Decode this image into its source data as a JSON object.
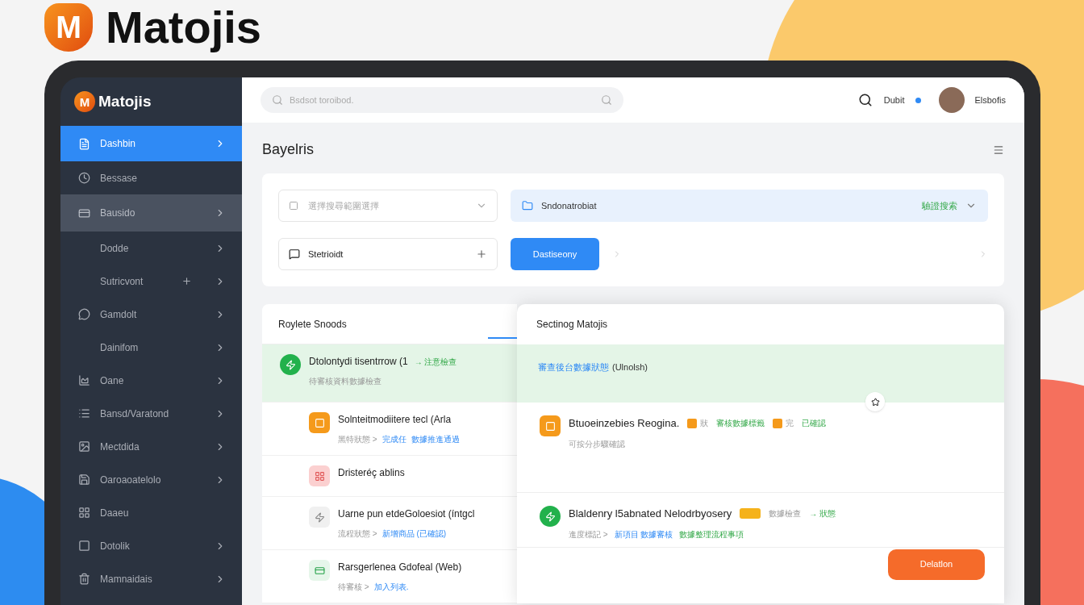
{
  "brand": {
    "mark": "M",
    "name": "Matojis"
  },
  "sidebar": {
    "brand": {
      "mark": "M",
      "name": "Matojis"
    },
    "items": [
      {
        "label": "Dashbin",
        "kind": "main",
        "selected": true,
        "highlighted": false,
        "plus": false,
        "chevron": true
      },
      {
        "label": "Bessase",
        "kind": "main",
        "selected": false,
        "highlighted": false,
        "plus": false,
        "chevron": false
      },
      {
        "label": "Bausido",
        "kind": "main",
        "selected": false,
        "highlighted": true,
        "plus": false,
        "chevron": true
      },
      {
        "label": "Dodde",
        "kind": "sub",
        "selected": false,
        "highlighted": false,
        "plus": false,
        "chevron": true
      },
      {
        "label": "Sutricvont",
        "kind": "sub",
        "selected": false,
        "highlighted": false,
        "plus": true,
        "chevron": true
      },
      {
        "label": "Gamdolt",
        "kind": "main",
        "selected": false,
        "highlighted": false,
        "plus": false,
        "chevron": true
      },
      {
        "label": "Dainifom",
        "kind": "sub",
        "selected": false,
        "highlighted": false,
        "plus": false,
        "chevron": true
      },
      {
        "label": "Oane",
        "kind": "main",
        "selected": false,
        "highlighted": false,
        "plus": false,
        "chevron": true
      },
      {
        "label": "Bansd/Varatond",
        "kind": "main",
        "selected": false,
        "highlighted": false,
        "plus": false,
        "chevron": true
      },
      {
        "label": "Mectdida",
        "kind": "main",
        "selected": false,
        "highlighted": false,
        "plus": false,
        "chevron": true
      },
      {
        "label": "Oaroaoatelolo",
        "kind": "main",
        "selected": false,
        "highlighted": false,
        "plus": false,
        "chevron": true
      },
      {
        "label": "Daaeu",
        "kind": "main",
        "selected": false,
        "highlighted": false,
        "plus": false,
        "chevron": false
      },
      {
        "label": "Dotolik",
        "kind": "main",
        "selected": false,
        "highlighted": false,
        "plus": false,
        "chevron": true
      },
      {
        "label": "Mamnaidais",
        "kind": "main",
        "selected": false,
        "highlighted": false,
        "plus": false,
        "chevron": true
      }
    ]
  },
  "topbar": {
    "search": {
      "placeholder": "Bsdsot toroibod."
    },
    "link": "Dubit",
    "user": "Elsbofis"
  },
  "page_title": "Bayelris",
  "filters": {
    "select_1": {
      "placeholder": "選擇搜尋範圍選擇"
    },
    "select_2": {
      "value": "Sndonatrobiat",
      "hint": "驗證搜索"
    },
    "field": {
      "value": "Stetrioidt"
    },
    "button": "Dastiseony"
  },
  "left_panel": {
    "title": "Roylete Snoods",
    "items": [
      {
        "kind": "green",
        "title": "Dtolontydi tisentrrow (1",
        "trail": "→ 注意檢查",
        "sub": "待審核資料數據檢查",
        "highlighted": true
      },
      {
        "kind": "orange",
        "title": "Solnteitmodiitere tecl (Arla",
        "sub": "黑特狀態 >",
        "highlighted": false,
        "links": [
          "完成任",
          "數據推進通過"
        ]
      },
      {
        "kind": "red",
        "title": "Dristeréç ablins",
        "highlighted": false
      },
      {
        "kind": "grey",
        "title": "Uarne pun etdeGoloesiot (íntgcl",
        "sub": "流程狀態 >",
        "highlighted": false,
        "links": [
          "新增商品 (已確認)"
        ]
      },
      {
        "kind": "card",
        "title": "Rarsgerlenea Gdofeal (Web)",
        "sub": "待審核 >",
        "highlighted": false,
        "links": [
          "加入列表."
        ]
      }
    ]
  },
  "right_panel": {
    "title": "Sectinog Matojis",
    "banner": {
      "link": "審查後台數據狀態",
      "text": "(Ulnolsh)"
    },
    "items": [
      {
        "kind": "orange",
        "title": "Btuoeinzebies Reogina.",
        "sub": "可按分步驟確認",
        "tags": [
          {
            "kind": "swatch",
            "text": "狀"
          },
          {
            "kind": "label",
            "text": "審核數據標籤"
          },
          {
            "kind": "swatch",
            "text": "完"
          },
          {
            "kind": "label",
            "text": "已確認"
          }
        ]
      },
      {
        "kind": "green",
        "title": "Blaldenry l5abnated Nelodrbyosery",
        "sub": "進度標記 >",
        "tags": [
          {
            "kind": "wide_swatch"
          },
          {
            "kind": "muted",
            "text": "數據檢查"
          },
          {
            "kind": "label",
            "text": "→ 狀態"
          }
        ],
        "links": [
          "新項目 數據審核",
          "數據整理流程事項"
        ]
      }
    ],
    "button": "Delatlon"
  }
}
